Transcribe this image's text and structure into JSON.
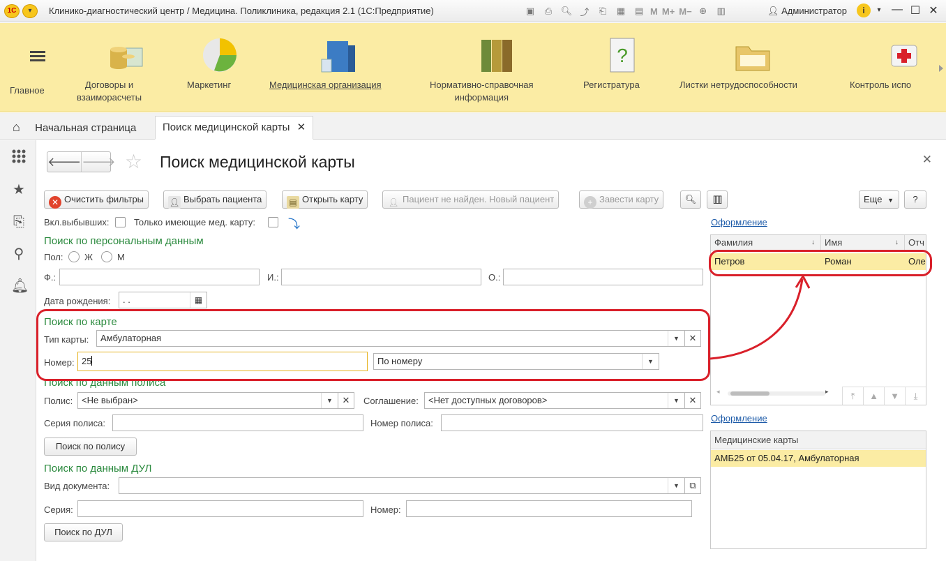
{
  "window": {
    "logo": "1С",
    "title": "Клинико-диагностический центр / Медицина. Поликлиника, редакция 2.1  (1С:Предприятие)",
    "toolbar_m": [
      "M",
      "M+",
      "M−"
    ],
    "user": "Администратор"
  },
  "sections": [
    {
      "label": "Главное",
      "icon": "menu-icon"
    },
    {
      "label": "Договоры и\nвзаиморасчеты",
      "icon": "coins-icon"
    },
    {
      "label": "Маркетинг",
      "icon": "pie-chart-icon"
    },
    {
      "label": "Медицинская организация",
      "icon": "building-icon"
    },
    {
      "label": "Нормативно-справочная\nинформация",
      "icon": "binders-icon"
    },
    {
      "label": "Регистратура",
      "icon": "question-doc-icon"
    },
    {
      "label": "Листки нетрудоспособности",
      "icon": "folder-icon"
    },
    {
      "label": "Контроль испо",
      "icon": "first-aid-icon"
    }
  ],
  "tabs": {
    "home": "Начальная страница",
    "current": "Поиск медицинской карты"
  },
  "form": {
    "title": "Поиск медицинской карты",
    "buttons": {
      "clear": "Очистить фильтры",
      "choose": "Выбрать пациента",
      "open": "Открыть карту",
      "not_found": "Пациент не найден. Новый пациент",
      "add_card": "Завести карту",
      "more": "Еще",
      "help": "?"
    },
    "include_dropped": "Вкл.выбывших:",
    "only_with_card": "Только имеющие мед. карту:",
    "personal": {
      "header": "Поиск по персональным данным",
      "sex_label": "Пол:",
      "female": "Ж",
      "male": "М",
      "f_label": "Ф.:",
      "i_label": "И.:",
      "o_label": "О.:",
      "birth_label": "Дата рождения:",
      "birth_value": " .  ."
    },
    "card": {
      "header": "Поиск по  карте",
      "type_label": "Тип карты:",
      "type_value": "Амбулаторная",
      "number_label": "Номер:",
      "number_value": "25",
      "mode_value": "По номеру"
    },
    "policy": {
      "header": "Поиск по данным полиса",
      "policy_label": "Полис:",
      "policy_value": "<Не выбран>",
      "agreement_label": "Соглашение:",
      "agreement_value": "<Нет доступных договоров>",
      "series_label": "Серия полиса:",
      "number_label": "Номер полиса:",
      "search_button": "Поиск по полису"
    },
    "dul": {
      "header": "Поиск по данным ДУЛ",
      "doc_label": "Вид документа:",
      "series_label": "Серия:",
      "number_label": "Номер:",
      "search_button": "Поиск по ДУЛ"
    }
  },
  "right": {
    "link1": "Оформление",
    "patients": {
      "columns": [
        "Фамилия",
        "Имя",
        "Отч"
      ],
      "rows": [
        [
          "Петров",
          "Роман",
          "Оле"
        ]
      ]
    },
    "link2": "Оформление",
    "cards": {
      "header": "Медицинские карты",
      "rows": [
        "АМБ25 от 05.04.17, Амбулаторная"
      ]
    }
  },
  "colors": {
    "section_bg": "#fbeca4",
    "highlight": "#d9202a",
    "group_header": "#2b8a3e",
    "link": "#1c5aa8"
  }
}
